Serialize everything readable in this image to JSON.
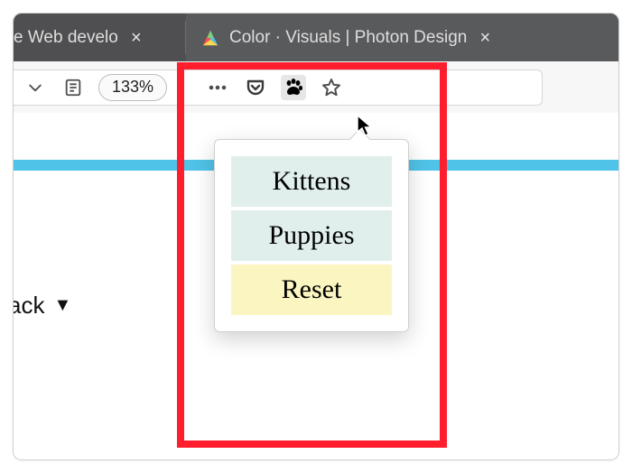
{
  "tabs": [
    {
      "title": "e Web develo"
    },
    {
      "title": "Color · Visuals | Photon Design"
    }
  ],
  "toolbar": {
    "zoom": "133%"
  },
  "page": {
    "partial_text": "ack"
  },
  "popup": {
    "items": [
      {
        "label": "Kittens",
        "style": "teal"
      },
      {
        "label": "Puppies",
        "style": "teal"
      },
      {
        "label": "Reset",
        "style": "yellow"
      }
    ]
  },
  "icons": {
    "chevron_down": "chevron-down",
    "reader": "reader",
    "overflow": "overflow",
    "pocket": "pocket",
    "paw": "paw",
    "star": "star",
    "close": "close",
    "favicon": "photon-favicon"
  }
}
